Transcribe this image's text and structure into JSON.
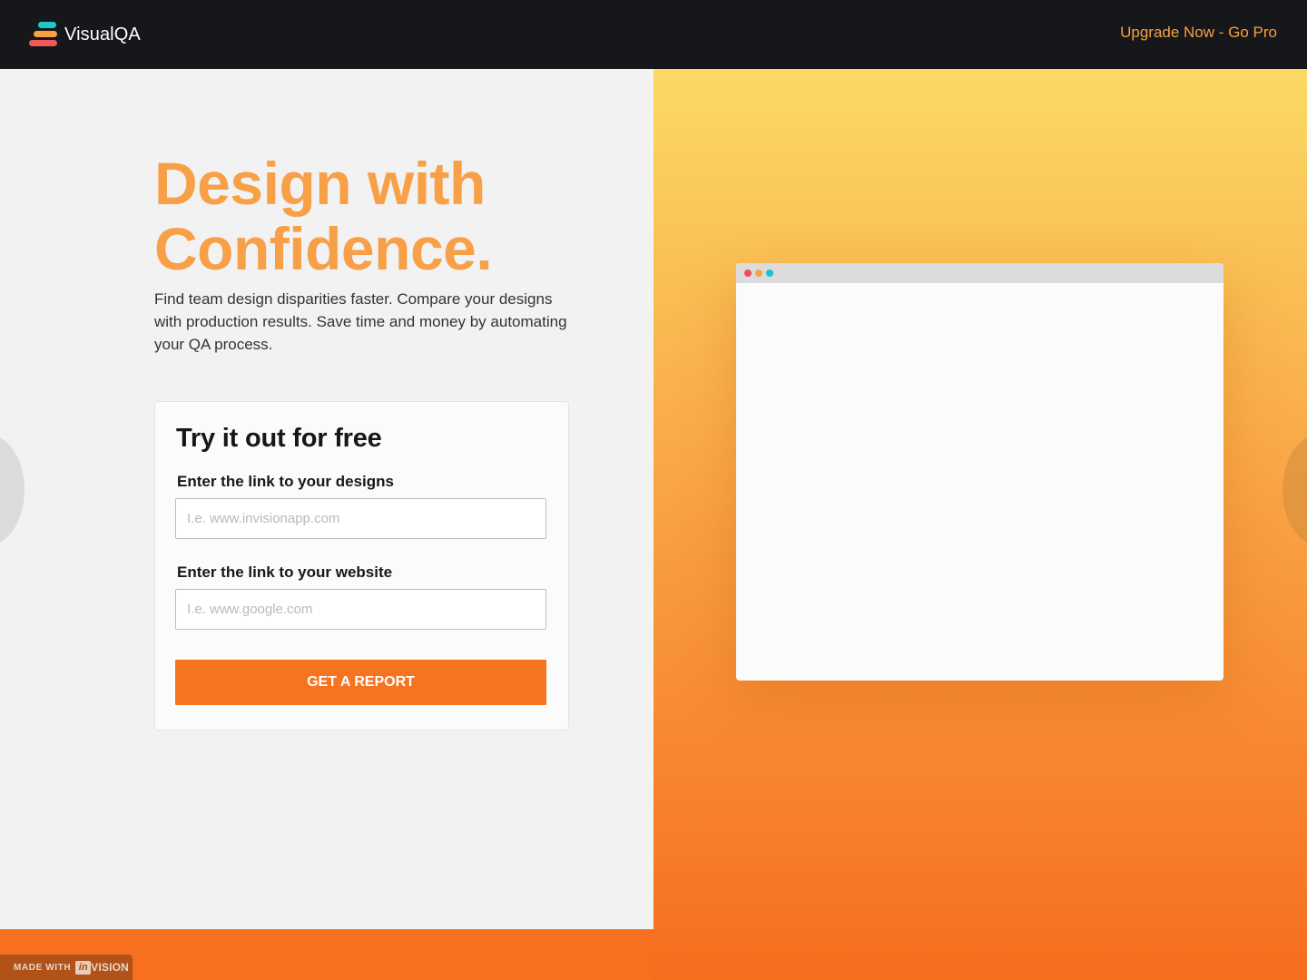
{
  "header": {
    "brand": "VisualQA",
    "upgrade_link": "Upgrade Now - Go Pro"
  },
  "hero": {
    "title_line1": "Design with",
    "title_line2": "Confidence.",
    "subtitle": "Find team design disparities faster. Compare your designs with production results. Save time and money by automating your QA process."
  },
  "form": {
    "title": "Try it out for free",
    "design_label": "Enter the link to your designs",
    "design_placeholder": "I.e. www.invisionapp.com",
    "design_value": "",
    "website_label": "Enter the link to your website",
    "website_placeholder": "I.e. www.google.com",
    "website_value": "",
    "submit_label": "GET A REPORT"
  },
  "badge": {
    "made_with": "MADE WITH",
    "in": "in",
    "vision": "VISION"
  },
  "colors": {
    "accent": "#f6731f",
    "title_orange": "#f7a047",
    "topbar": "#16171a",
    "gradient_top": "#fbd964",
    "gradient_bottom": "#f66d1e"
  },
  "icons": {
    "logo": "stacked-bars-logo-icon",
    "carousel_prev": "chevron-left-icon",
    "carousel_next": "chevron-right-icon"
  }
}
